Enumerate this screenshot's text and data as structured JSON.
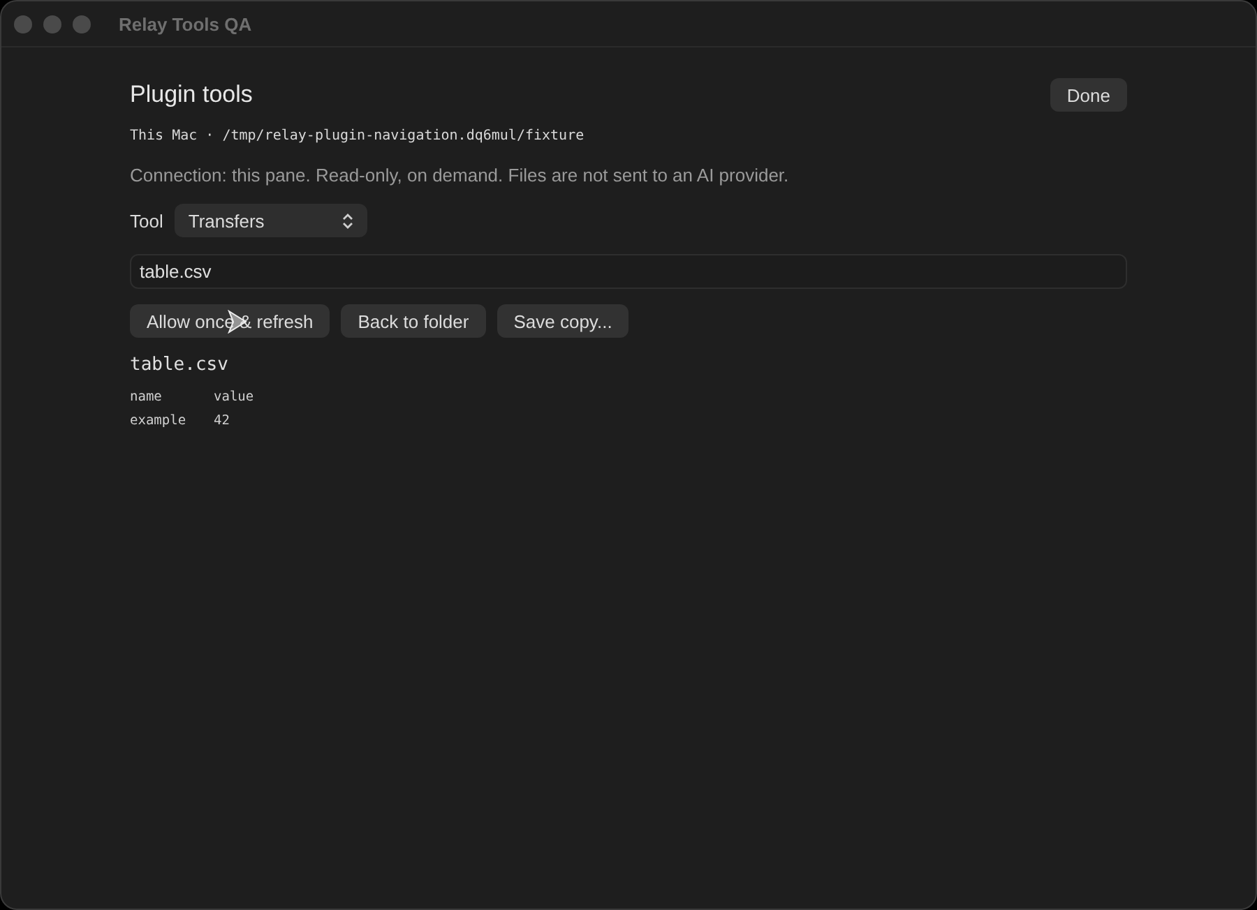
{
  "window": {
    "title": "Relay Tools QA"
  },
  "header": {
    "title": "Plugin tools",
    "done_button": "Done"
  },
  "location": "This Mac · /tmp/relay-plugin-navigation.dq6mul/fixture",
  "connection_note": "Connection: this pane. Read-only, on demand. Files are not sent to an AI provider.",
  "tool": {
    "label": "Tool",
    "value": "Transfers"
  },
  "path_field": {
    "value": "table.csv"
  },
  "actions": [
    "Allow once & refresh",
    "Back to folder",
    "Save copy..."
  ],
  "preview": {
    "title": "table.csv",
    "rows": [
      [
        "name",
        "value"
      ],
      [
        "example",
        "42"
      ]
    ]
  }
}
